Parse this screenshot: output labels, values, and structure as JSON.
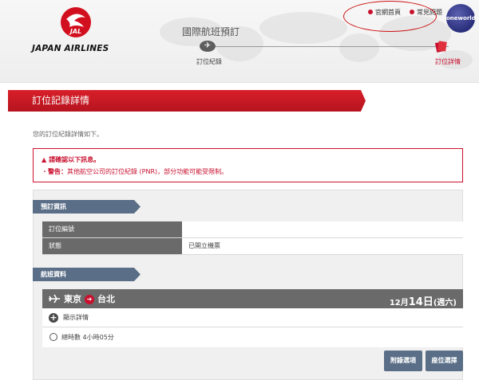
{
  "header": {
    "logo_text": "JAPAN AIRLINES",
    "logo_badge": "JAL",
    "page_title": "國際航班預訂",
    "links": {
      "home": "官網首頁",
      "faq": "常見問題"
    },
    "oneworld": "oneworld",
    "steps": [
      {
        "label": "訂位紀錄"
      },
      {
        "label": "訂位詳情"
      }
    ]
  },
  "page": {
    "section_title": "訂位記錄詳情",
    "intro": "您的訂位紀錄詳情如下。"
  },
  "notice": {
    "title": "請確認以下訊息。",
    "prefix": "警告：",
    "text": "其他航空公司的訂位紀錄 (PNR)，部分功能可能受限制。"
  },
  "booking_info": {
    "tag": "預訂資訊",
    "rows": [
      {
        "label": "訂位編號",
        "value": ""
      },
      {
        "label": "狀態",
        "value": "已開立機票"
      }
    ]
  },
  "flight_info": {
    "tag": "航班資料",
    "origin": "東京",
    "destination": "台北",
    "month": "12月",
    "day": "14日",
    "weekday": "(週六)",
    "details_label": "顯示詳情",
    "duration_label": "總時數 4小時05分",
    "buttons": {
      "extras": "附錄選項",
      "seats": "座位選擇"
    }
  }
}
